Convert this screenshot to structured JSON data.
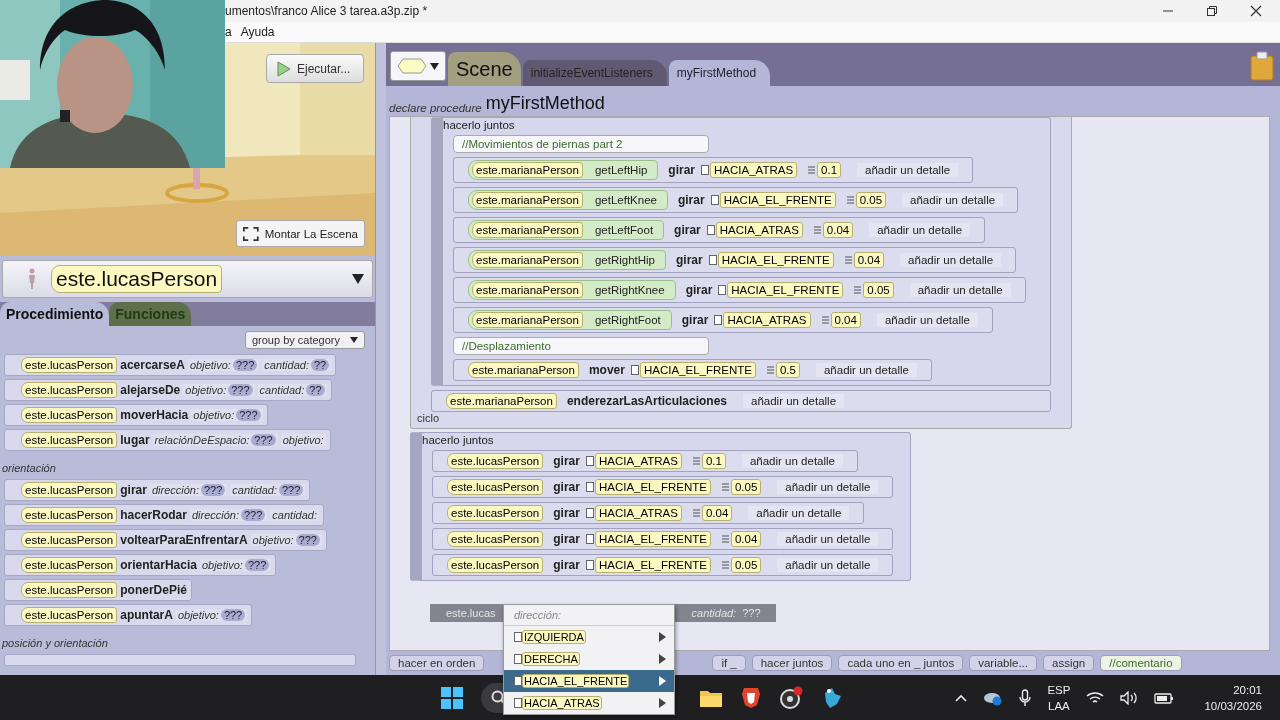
{
  "window": {
    "title": "umentos\\franco Alice 3 tarea.a3p.zip *"
  },
  "menu_bar": [
    "a",
    "Ayuda"
  ],
  "webcam": {
    "kind": "picture"
  },
  "scene_view": {
    "kind": "picture",
    "run_button": "Ejecutar...",
    "setup_button": "Montar La Escena"
  },
  "object_selector": {
    "value": "este.lucasPerson"
  },
  "palette_tabs": [
    {
      "label": "Procedimiento",
      "selected": true
    },
    {
      "label": "Funciones",
      "selected": false
    }
  ],
  "group_by": "group by category",
  "procedure_groups": [
    {
      "items": [
        {
          "target": "este.lucasPerson",
          "method": "acercarseA",
          "params": [
            {
              "name": "objetivo:",
              "value": "???"
            },
            {
              "name": "cantidad:",
              "value": "??"
            }
          ]
        },
        {
          "target": "este.lucasPerson",
          "method": "alejarseDe",
          "params": [
            {
              "name": "objetivo:",
              "value": "???"
            },
            {
              "name": "cantidad:",
              "value": "??"
            }
          ]
        },
        {
          "target": "este.lucasPerson",
          "method": "moverHacia",
          "params": [
            {
              "name": "objetivo:",
              "value": "???"
            }
          ]
        },
        {
          "target": "este.lucasPerson",
          "method": "lugar",
          "params": [
            {
              "name": "relaciónDeEspacio:",
              "value": "???"
            },
            {
              "name": "objetivo:"
            }
          ]
        }
      ]
    },
    {
      "heading": "orientación",
      "items": [
        {
          "target": "este.lucasPerson",
          "method": "girar",
          "params": [
            {
              "name": "dirección:",
              "value": "???"
            },
            {
              "name": "cantidad:",
              "value": "???"
            }
          ]
        },
        {
          "target": "este.lucasPerson",
          "method": "hacerRodar",
          "params": [
            {
              "name": "dirección:",
              "value": "???"
            },
            {
              "name": "cantidad:"
            }
          ]
        },
        {
          "target": "este.lucasPerson",
          "method": "voltearParaEnfrentarA",
          "params": [
            {
              "name": "objetivo:",
              "value": "???"
            }
          ]
        },
        {
          "target": "este.lucasPerson",
          "method": "orientarHacia",
          "params": [
            {
              "name": "objetivo:",
              "value": "???"
            }
          ]
        },
        {
          "target": "este.lucasPerson",
          "method": "ponerDePié"
        },
        {
          "target": "este.lucasPerson",
          "method": "apuntarA",
          "params": [
            {
              "name": "objetivo:",
              "value": "???"
            }
          ]
        }
      ]
    },
    {
      "heading": "posición y orientación"
    }
  ],
  "class_tab": "Scene",
  "editor_tabs": [
    {
      "label": "initializeEventListeners",
      "selected": false
    },
    {
      "label": "myFirstMethod",
      "selected": true
    }
  ],
  "declaration": {
    "prefix": "declare procedure",
    "name": "myFirstMethod"
  },
  "code": [
    {
      "kind": "loop",
      "footer": "ciclo",
      "children": [
        {
          "kind": "do_together",
          "label": "hacerlo juntos",
          "children": [
            {
              "kind": "comment",
              "text": "//Movimientos de piernas part 2"
            },
            {
              "kind": "statement",
              "target": "este.marianaPerson",
              "joint": "getLeftHip",
              "verb": "girar",
              "direction": "HACIA_ATRAS",
              "amount": "0.1",
              "detail": "añadir un detalle"
            },
            {
              "kind": "statement",
              "target": "este.marianaPerson",
              "joint": "getLeftKnee",
              "verb": "girar",
              "direction": "HACIA_EL_FRENTE",
              "amount": "0.05",
              "detail": "añadir un detalle"
            },
            {
              "kind": "statement",
              "target": "este.marianaPerson",
              "joint": "getLeftFoot",
              "verb": "girar",
              "direction": "HACIA_ATRAS",
              "amount": "0.04",
              "detail": "añadir un detalle"
            },
            {
              "kind": "statement",
              "target": "este.marianaPerson",
              "joint": "getRightHip",
              "verb": "girar",
              "direction": "HACIA_EL_FRENTE",
              "amount": "0.04",
              "detail": "añadir un detalle"
            },
            {
              "kind": "statement",
              "target": "este.marianaPerson",
              "joint": "getRightKnee",
              "verb": "girar",
              "direction": "HACIA_EL_FRENTE",
              "amount": "0.05",
              "detail": "añadir un detalle"
            },
            {
              "kind": "statement",
              "target": "este.marianaPerson",
              "joint": "getRightFoot",
              "verb": "girar",
              "direction": "HACIA_ATRAS",
              "amount": "0.04",
              "detail": "añadir un detalle"
            },
            {
              "kind": "comment",
              "text": "//Desplazamiento"
            },
            {
              "kind": "statement",
              "target": "este.marianaPerson",
              "verb": "mover",
              "direction": "HACIA_EL_FRENTE",
              "amount": "0.5",
              "detail": "añadir un detalle"
            }
          ]
        },
        {
          "kind": "statement",
          "target": "este.marianaPerson",
          "verb": "enderezarLasArticulaciones",
          "detail": "añadir un detalle"
        }
      ]
    },
    {
      "kind": "do_together",
      "label": "hacerlo juntos",
      "children": [
        {
          "kind": "statement",
          "target": "este.lucasPerson",
          "verb": "girar",
          "direction": "HACIA_ATRAS",
          "amount": "0.1",
          "detail": "añadir un detalle"
        },
        {
          "kind": "statement",
          "target": "este.lucasPerson",
          "verb": "girar",
          "direction": "HACIA_EL_FRENTE",
          "amount": "0.05",
          "detail": "añadir un detalle"
        },
        {
          "kind": "statement",
          "target": "este.lucasPerson",
          "verb": "girar",
          "direction": "HACIA_ATRAS",
          "amount": "0.04",
          "detail": "añadir un detalle"
        },
        {
          "kind": "statement",
          "target": "este.lucasPerson",
          "verb": "girar",
          "direction": "HACIA_EL_FRENTE",
          "amount": "0.04",
          "detail": "añadir un detalle"
        },
        {
          "kind": "statement",
          "target": "este.lucasPerson",
          "verb": "girar",
          "direction": "HACIA_EL_FRENTE",
          "amount": "0.05",
          "detail": "añadir un detalle"
        }
      ]
    }
  ],
  "bottom_palette": [
    {
      "label": "hacer en orden",
      "kind": "control"
    },
    {
      "label": "if _",
      "kind": "control"
    },
    {
      "label": "hacer juntos",
      "kind": "control"
    },
    {
      "label": "cada uno en _ juntos",
      "kind": "control"
    },
    {
      "label": "variable...",
      "kind": "control"
    },
    {
      "label": "assign",
      "kind": "control"
    },
    {
      "label": "//comentario",
      "kind": "comment"
    }
  ],
  "drag_preview": {
    "target": "este.lucas",
    "param": "cantidad:",
    "value": "???"
  },
  "direction_menu": {
    "heading": "dirección:",
    "options": [
      {
        "label": "IZQUIERDA",
        "selected": false
      },
      {
        "label": "DERECHA",
        "selected": false
      },
      {
        "label": "HACIA_EL_FRENTE",
        "selected": true
      },
      {
        "label": "HACIA_ATRAS",
        "selected": false
      }
    ]
  },
  "taskbar": {
    "language": "ESP",
    "layout": "LAA",
    "time": "20:01",
    "date": "10/03/2026"
  }
}
